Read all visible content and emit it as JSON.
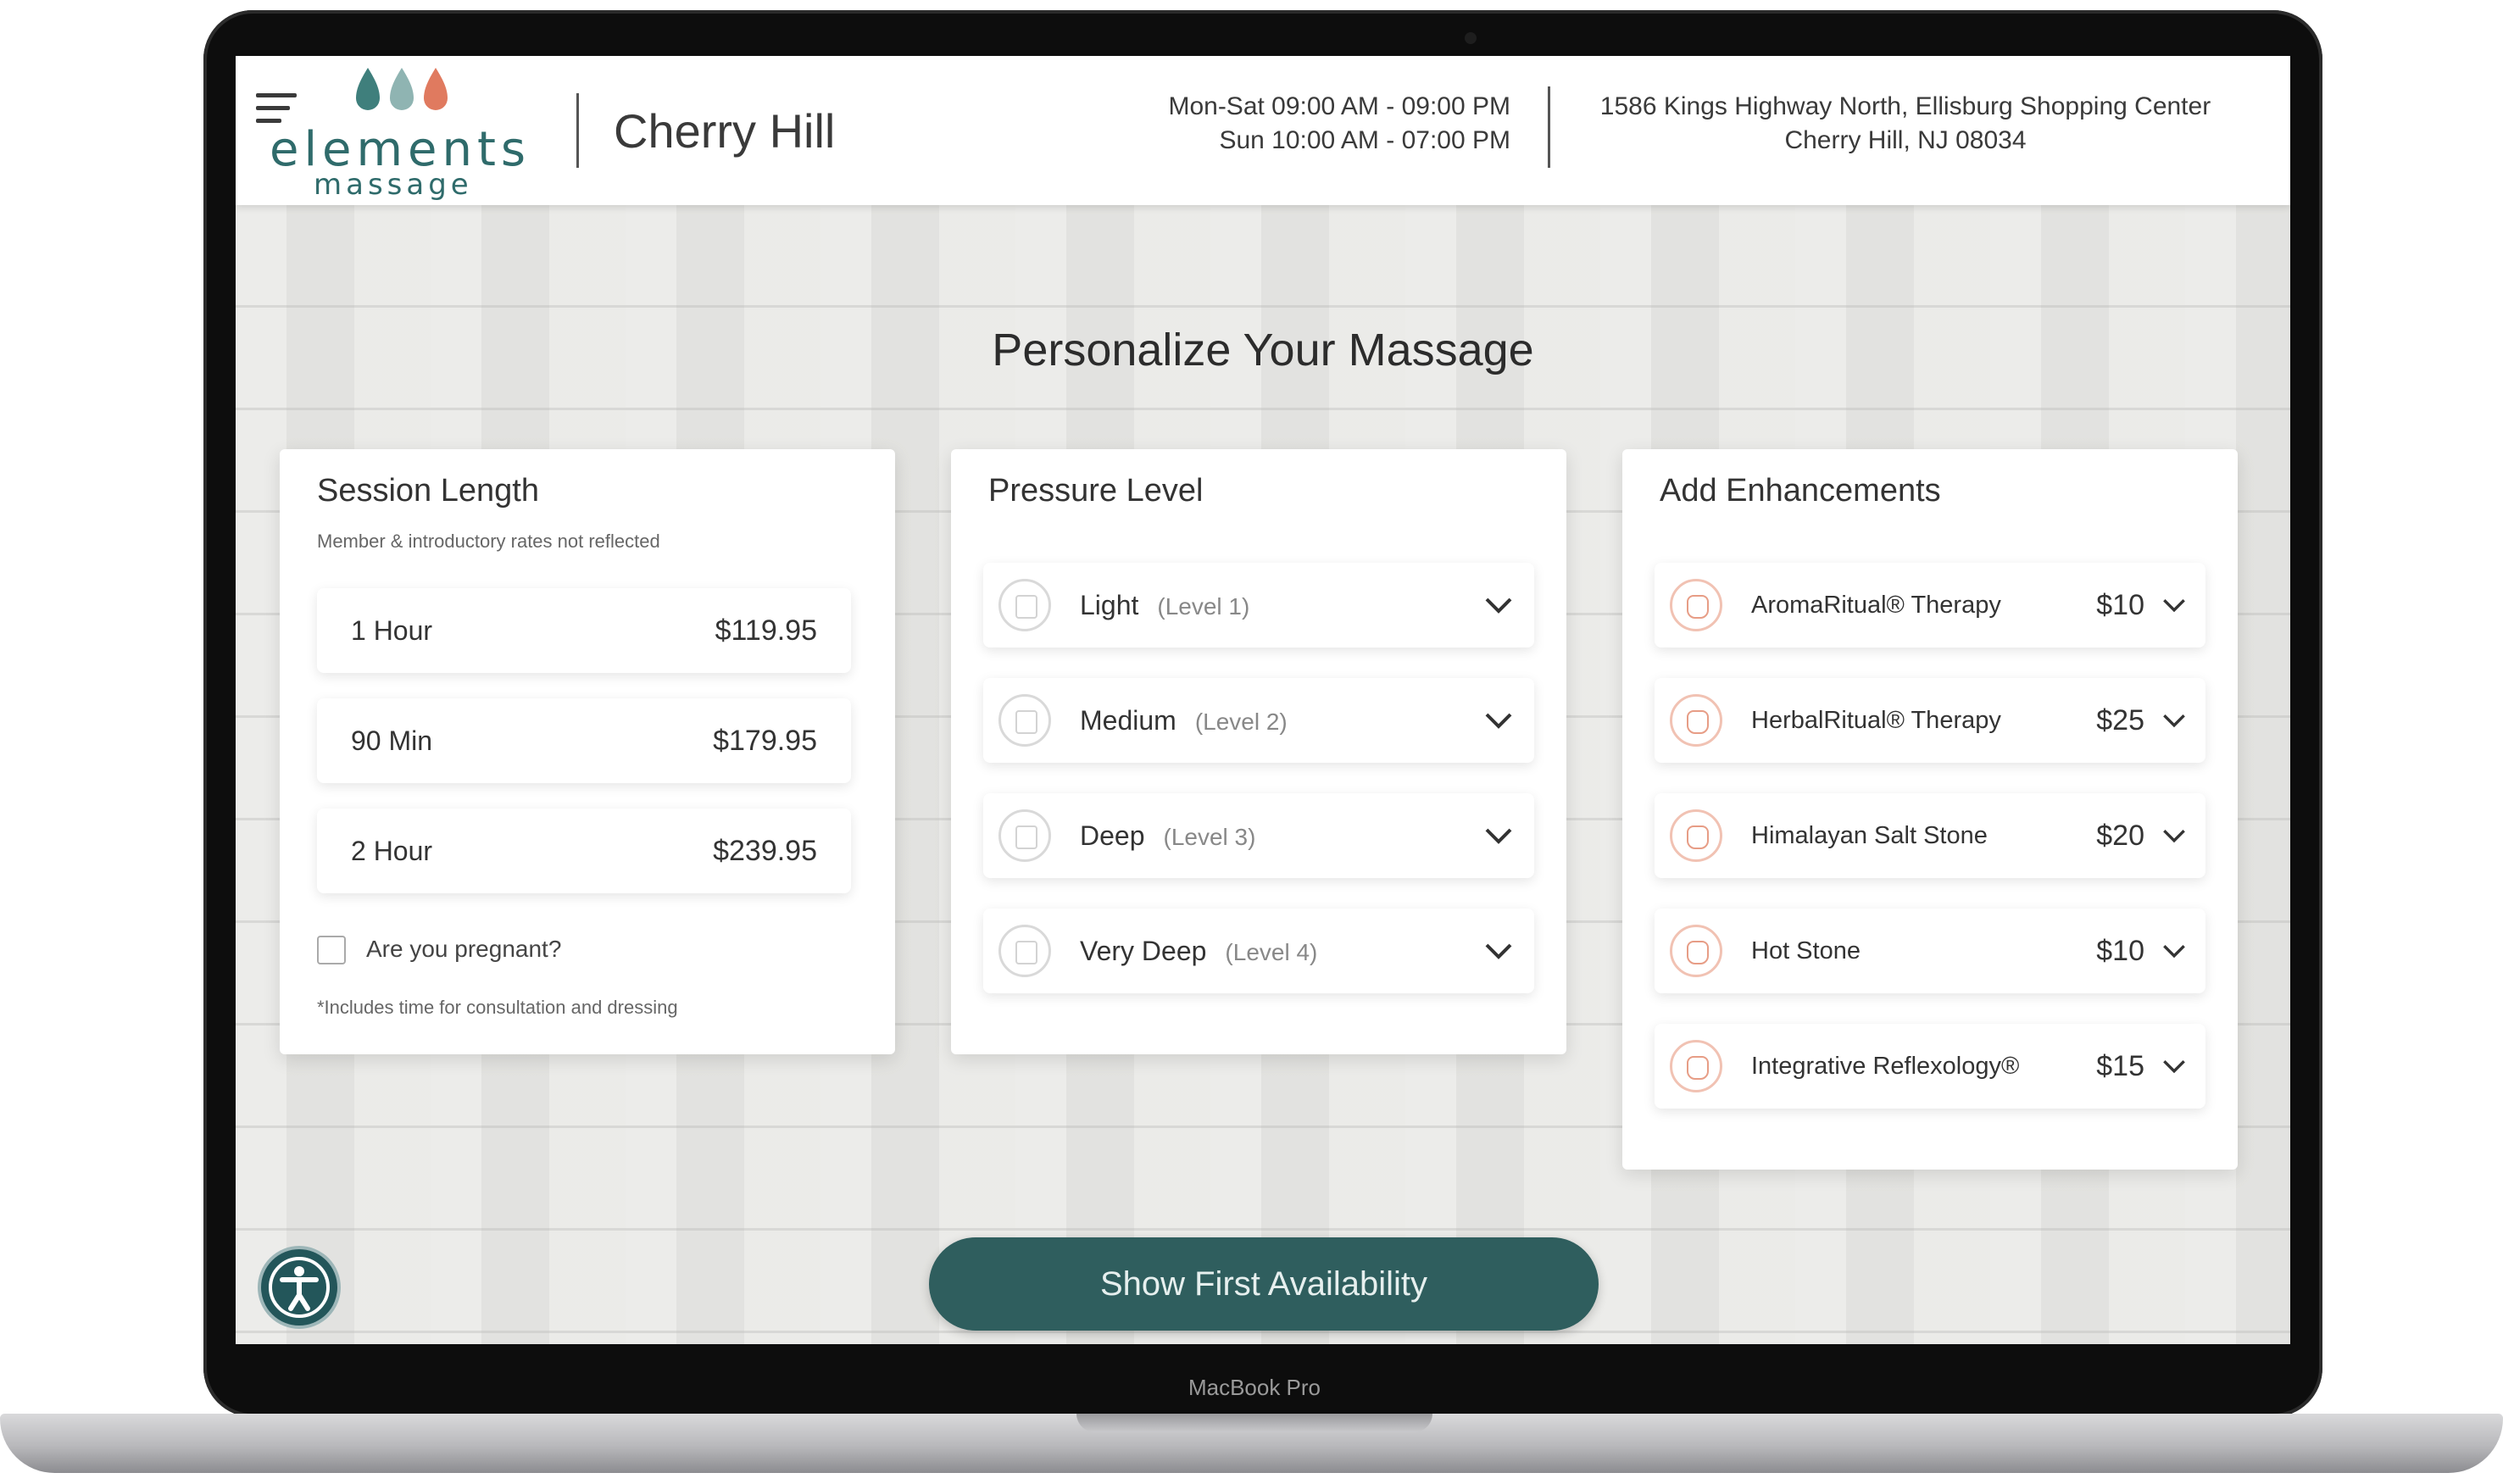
{
  "header": {
    "logo_word": "elements",
    "logo_sub": "massage",
    "location": "Cherry Hill",
    "hours": [
      "Mon-Sat 09:00 AM - 09:00 PM",
      "Sun 10:00 AM - 07:00 PM"
    ],
    "address": [
      "1586 Kings Highway North, Ellisburg Shopping Center",
      "Cherry Hill, NJ 08034"
    ]
  },
  "page_title": "Personalize Your Massage",
  "session": {
    "title": "Session Length",
    "note": "Member & introductory rates not reflected",
    "options": [
      {
        "label": "1 Hour",
        "price": "$119.95"
      },
      {
        "label": "90 Min",
        "price": "$179.95"
      },
      {
        "label": "2 Hour",
        "price": "$239.95"
      }
    ],
    "pregnant_label": "Are you pregnant?",
    "footnote": "*Includes time for consultation and dressing"
  },
  "pressure": {
    "title": "Pressure Level",
    "options": [
      {
        "label": "Light",
        "level": "(Level 1)"
      },
      {
        "label": "Medium",
        "level": "(Level 2)"
      },
      {
        "label": "Deep",
        "level": "(Level 3)"
      },
      {
        "label": "Very Deep",
        "level": "(Level 4)"
      }
    ]
  },
  "enhancements": {
    "title": "Add Enhancements",
    "options": [
      {
        "label": "AromaRitual® Therapy",
        "price": "$10"
      },
      {
        "label": "HerbalRitual® Therapy",
        "price": "$25"
      },
      {
        "label": "Himalayan Salt Stone",
        "price": "$20"
      },
      {
        "label": "Hot Stone",
        "price": "$10"
      },
      {
        "label": "Integrative Reflexology®",
        "price": "$15"
      }
    ]
  },
  "cta_label": "Show First Availability",
  "device_label": "MacBook Pro",
  "colors": {
    "brand_teal": "#2f6b6b",
    "cta": "#2f5e5e",
    "accent_coral": "#e79d86"
  },
  "icons": {
    "menu": "hamburger-icon",
    "accessibility": "accessibility-icon",
    "chevron": "chevron-down-icon"
  }
}
